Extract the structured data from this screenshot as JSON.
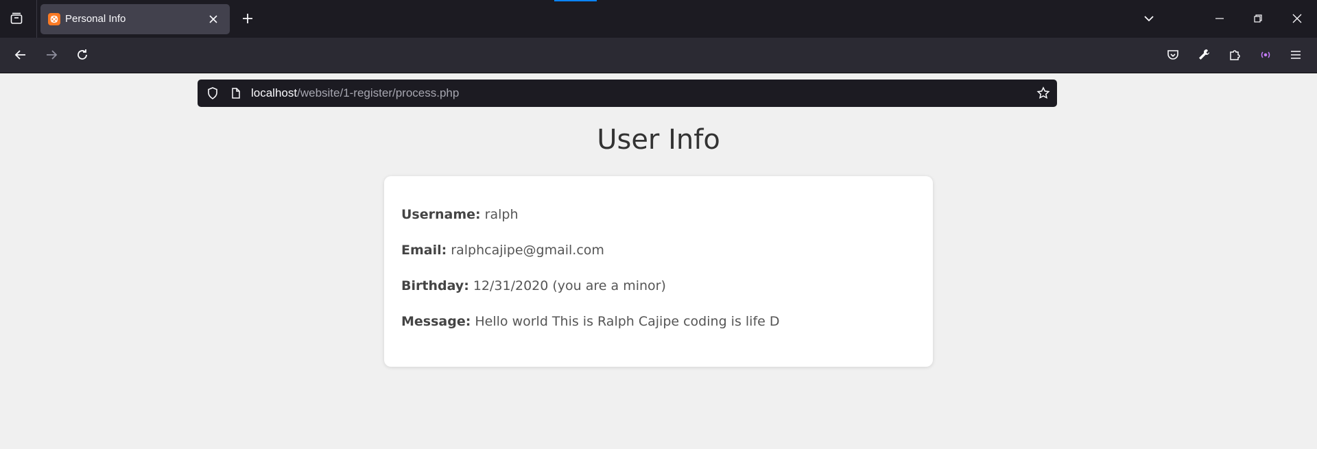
{
  "browser": {
    "tab": {
      "title": "Personal Info"
    },
    "url": {
      "host": "localhost",
      "path": "/website/1-register/process.php"
    }
  },
  "page": {
    "title": "User Info",
    "fields": [
      {
        "label": "Username:",
        "value": "ralph"
      },
      {
        "label": "Email:",
        "value": "ralphcajipe@gmail.com"
      },
      {
        "label": "Birthday:",
        "value": "12/31/2020 (you are a minor)"
      },
      {
        "label": "Message:",
        "value": "Hello world This is Ralph Cajipe coding is life D"
      }
    ]
  }
}
